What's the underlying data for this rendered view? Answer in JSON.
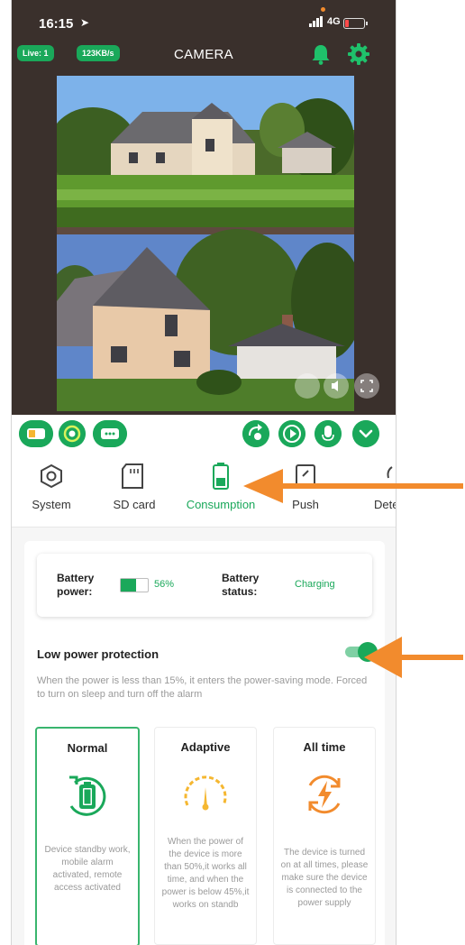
{
  "status_bar": {
    "time": "16:15",
    "network": "4G"
  },
  "header": {
    "live_badge": "Live: 1",
    "rate_badge": "123KB/s",
    "title": "CAMERA",
    "bell_icon": "bell-icon",
    "settings_icon": "gear-icon"
  },
  "tabs": [
    {
      "label": "System",
      "icon": "system-icon"
    },
    {
      "label": "SD card",
      "icon": "sd-card-icon"
    },
    {
      "label": "Consumption",
      "icon": "battery-icon"
    },
    {
      "label": "Push",
      "icon": "push-icon"
    },
    {
      "label": "Dete",
      "icon": "detect-icon"
    }
  ],
  "battery": {
    "power_label": "Battery power:",
    "power_value": "56%",
    "power_fraction": 0.56,
    "status_label": "Battery status:",
    "status_value": "Charging"
  },
  "low_power": {
    "title": "Low power protection",
    "enabled": true,
    "description": "When the power is less than 15%, it enters the power-saving mode. Forced to turn on sleep and turn off the alarm"
  },
  "modes": [
    {
      "title": "Normal",
      "selected": true,
      "description": "Device standby work, mobile alarm activated, remote access activated"
    },
    {
      "title": "Adaptive",
      "selected": false,
      "description": "When the power of the device is more than 50%,it works all time, and when the power is below 45%,it works on standb"
    },
    {
      "title": "All time",
      "selected": false,
      "description": "The device is turned on at all times, please make sure the device is connected to the power supply"
    }
  ],
  "colors": {
    "accent": "#1aa85a",
    "adaptive": "#f5b731",
    "alltime": "#f28b2d",
    "annotation_arrow": "#f28b2d",
    "dark_bg": "#3a302c"
  }
}
